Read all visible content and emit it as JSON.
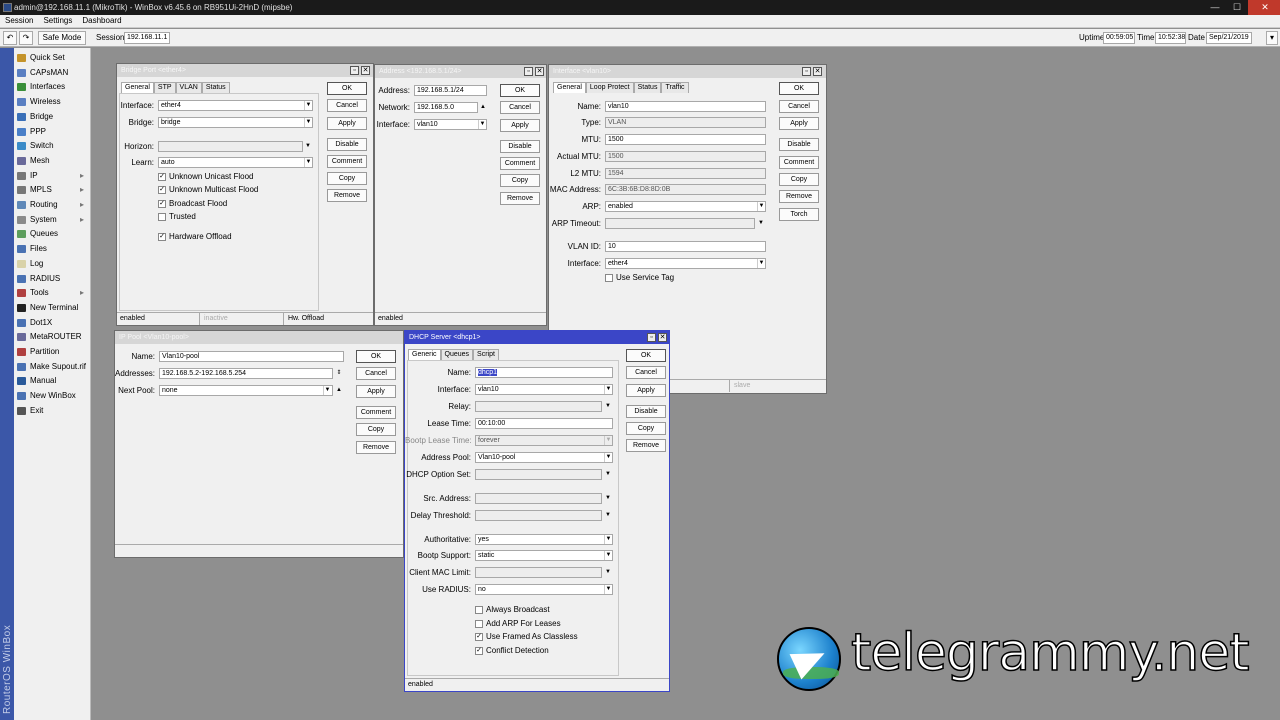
{
  "window": {
    "title": "admin@192.168.11.1 (MikroTik) - WinBox v6.45.6 on RB951Ui-2HnD (mipsbe)",
    "min": "—",
    "max": "☐",
    "close": "✕"
  },
  "menu": [
    "Session",
    "Settings",
    "Dashboard"
  ],
  "toolbar": {
    "undo": "↶",
    "redo": "↷",
    "safe_mode": "Safe Mode",
    "session_label": "Session:",
    "session_value": "192.168.11.1",
    "uptime_label": "Uptime",
    "uptime": "00:59:05",
    "time_label": "Time",
    "time": "10:52:38",
    "date_label": "Date",
    "date": "Sep/21/2019"
  },
  "sidebar": {
    "brand": "RouterOS WinBox",
    "items": [
      {
        "label": "Quick Set",
        "color": "#c4932a",
        "arrow": ""
      },
      {
        "label": "CAPsMAN",
        "color": "#5a7fc2",
        "arrow": ""
      },
      {
        "label": "Interfaces",
        "color": "#3a8f3a",
        "arrow": ""
      },
      {
        "label": "Wireless",
        "color": "#5a7fc2",
        "arrow": ""
      },
      {
        "label": "Bridge",
        "color": "#3a6fb8",
        "arrow": ""
      },
      {
        "label": "PPP",
        "color": "#4a7fc8",
        "arrow": ""
      },
      {
        "label": "Switch",
        "color": "#3b8bc8",
        "arrow": ""
      },
      {
        "label": "Mesh",
        "color": "#6a6a9a",
        "arrow": ""
      },
      {
        "label": "IP",
        "color": "#777",
        "arrow": "▸"
      },
      {
        "label": "MPLS",
        "color": "#777",
        "arrow": "▸"
      },
      {
        "label": "Routing",
        "color": "#5f88b8",
        "arrow": "▸"
      },
      {
        "label": "System",
        "color": "#8a8a8a",
        "arrow": "▸"
      },
      {
        "label": "Queues",
        "color": "#5d9e5d",
        "arrow": ""
      },
      {
        "label": "Files",
        "color": "#4a72b3",
        "arrow": ""
      },
      {
        "label": "Log",
        "color": "#d9d2a8",
        "arrow": ""
      },
      {
        "label": "RADIUS",
        "color": "#4a72b3",
        "arrow": ""
      },
      {
        "label": "Tools",
        "color": "#b04040",
        "arrow": "▸"
      },
      {
        "label": "New Terminal",
        "color": "#222",
        "arrow": ""
      },
      {
        "label": "Dot1X",
        "color": "#4a72b3",
        "arrow": ""
      },
      {
        "label": "MetaROUTER",
        "color": "#6a6a9a",
        "arrow": ""
      },
      {
        "label": "Partition",
        "color": "#b04040",
        "arrow": ""
      },
      {
        "label": "Make Supout.rif",
        "color": "#4a72b3",
        "arrow": ""
      },
      {
        "label": "Manual",
        "color": "#2a5a9a",
        "arrow": ""
      },
      {
        "label": "New WinBox",
        "color": "#4a72b3",
        "arrow": ""
      },
      {
        "label": "Exit",
        "color": "#555",
        "arrow": ""
      }
    ]
  },
  "common": {
    "ok": "OK",
    "cancel": "Cancel",
    "apply": "Apply",
    "disable": "Disable",
    "comment": "Comment",
    "copy": "Copy",
    "remove": "Remove",
    "torch": "Torch",
    "dd": "▼",
    "up": "▲",
    "updown": "⇕",
    "check": "✓"
  },
  "bridge_port": {
    "title": "Bridge Port <ether4>",
    "tabs": [
      "General",
      "STP",
      "VLAN",
      "Status"
    ],
    "interface_label": "Interface:",
    "interface": "ether4",
    "bridge_label": "Bridge:",
    "bridge": "bridge",
    "horizon_label": "Horizon:",
    "horizon": "",
    "learn_label": "Learn:",
    "learn": "auto",
    "checks": [
      {
        "label": "Unknown Unicast Flood",
        "checked": "✓"
      },
      {
        "label": "Unknown Multicast Flood",
        "checked": "✓"
      },
      {
        "label": "Broadcast Flood",
        "checked": "✓"
      },
      {
        "label": "Trusted",
        "checked": ""
      },
      {
        "label": "Hardware Offload",
        "checked": "✓"
      }
    ],
    "status": [
      "enabled",
      "inactive",
      "Hw. Offload"
    ]
  },
  "address": {
    "title": "Address <192.168.5.1/24>",
    "address_label": "Address:",
    "address": "192.168.5.1/24",
    "network_label": "Network:",
    "network": "192.168.5.0",
    "interface_label": "Interface:",
    "interface": "vlan10",
    "status": "enabled"
  },
  "iface": {
    "title": "Interface <vlan10>",
    "tabs": [
      "General",
      "Loop Protect",
      "Status",
      "Traffic"
    ],
    "fields": [
      {
        "label": "Name:",
        "value": "vlan10"
      },
      {
        "label": "Type:",
        "value": "VLAN"
      },
      {
        "label": "MTU:",
        "value": "1500"
      },
      {
        "label": "Actual MTU:",
        "value": "1500"
      },
      {
        "label": "L2 MTU:",
        "value": "1594"
      },
      {
        "label": "MAC Address:",
        "value": "6C:3B:6B:D8:8D:0B"
      },
      {
        "label": "ARP:",
        "value": "enabled"
      },
      {
        "label": "ARP Timeout:",
        "value": ""
      }
    ],
    "vlan_id_label": "VLAN ID:",
    "vlan_id": "10",
    "interface_label": "Interface:",
    "interface": "ether4",
    "service_tag": "Use Service Tag",
    "status_slave": "slave"
  },
  "ip_pool": {
    "title": "IP Pool <Vlan10-pool>",
    "name_label": "Name:",
    "name": "Vlan10-pool",
    "addresses_label": "Addresses:",
    "addresses": "192.168.5.2-192.168.5.254",
    "next_pool_label": "Next Pool:",
    "next_pool": "none"
  },
  "dhcp": {
    "title": "DHCP Server <dhcp1>",
    "tabs": [
      "Generic",
      "Queues",
      "Script"
    ],
    "fields": [
      {
        "label": "Name:",
        "value": "dhcp1"
      },
      {
        "label": "Interface:",
        "value": "vlan10"
      },
      {
        "label": "Relay:",
        "value": ""
      },
      {
        "label": "Lease Time:",
        "value": "00:10:00"
      },
      {
        "label": "Bootp Lease Time:",
        "value": "forever"
      },
      {
        "label": "Address Pool:",
        "value": "Vlan10-pool"
      },
      {
        "label": "DHCP Option Set:",
        "value": ""
      },
      {
        "label": "Src. Address:",
        "value": ""
      },
      {
        "label": "Delay Threshold:",
        "value": ""
      },
      {
        "label": "Authoritative:",
        "value": "yes"
      },
      {
        "label": "Bootp Support:",
        "value": "static"
      },
      {
        "label": "Client MAC Limit:",
        "value": ""
      },
      {
        "label": "Use RADIUS:",
        "value": "no"
      }
    ],
    "checks": [
      {
        "label": "Always Broadcast",
        "checked": ""
      },
      {
        "label": "Add ARP For Leases",
        "checked": ""
      },
      {
        "label": "Use Framed As Classless",
        "checked": "✓"
      },
      {
        "label": "Conflict Detection",
        "checked": "✓"
      }
    ],
    "status": "enabled"
  },
  "watermark": "telegrammy.net"
}
